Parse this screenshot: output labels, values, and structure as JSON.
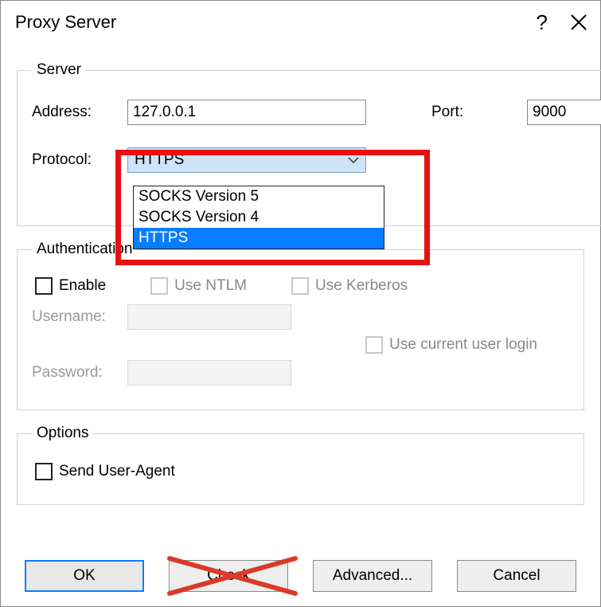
{
  "title": "Proxy Server",
  "server": {
    "legend": "Server",
    "address_label": "Address:",
    "address_value": "127.0.0.1",
    "port_label": "Port:",
    "port_value": "9000",
    "protocol_label": "Protocol:",
    "protocol_selected": "HTTPS",
    "protocol_options": [
      "SOCKS Version 5",
      "SOCKS Version 4",
      "HTTPS"
    ]
  },
  "auth": {
    "legend": "Authentication",
    "enable": "Enable",
    "use_ntlm": "Use NTLM",
    "use_kerberos": "Use Kerberos",
    "username_label": "Username:",
    "password_label": "Password:",
    "use_current": "Use current user login"
  },
  "options": {
    "legend": "Options",
    "send_ua": "Send User-Agent"
  },
  "buttons": {
    "ok": "OK",
    "check": "Check",
    "advanced": "Advanced...",
    "cancel": "Cancel"
  }
}
